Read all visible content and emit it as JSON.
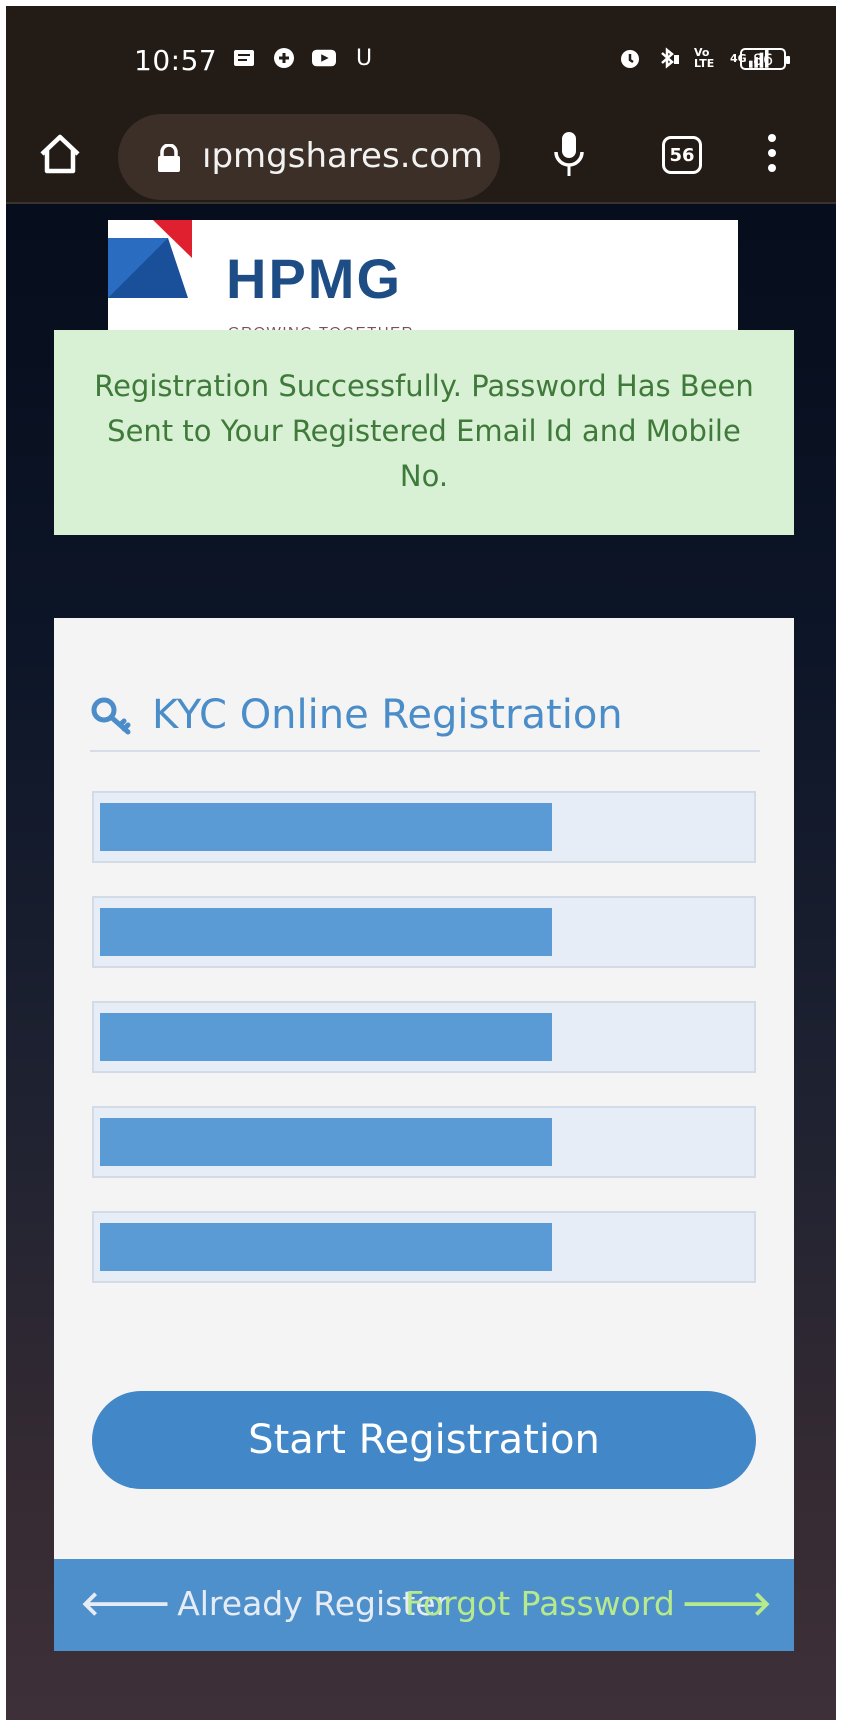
{
  "status_bar": {
    "time": "10:57",
    "left_icons": [
      "message-icon",
      "sync-icon",
      "youtube-icon",
      "u-icon"
    ],
    "u_label": "U",
    "network_label": "Vo LTE",
    "signal_label": "4G",
    "battery": "86"
  },
  "browser": {
    "url": "ıpmgshares.com",
    "tab_count": "56"
  },
  "logo": {
    "brand": "HPMG",
    "tagline": "GROWING TOGETHER",
    "colors": {
      "navy": "#1d4d84",
      "red": "#e0202f",
      "blue": "#1a4f9a"
    }
  },
  "alert": {
    "message": "Registration Successfully. Password Has Been Sent to Your Registered Email Id and Mobile No."
  },
  "form": {
    "title": "KYC Online Registration",
    "fields": [
      {
        "value": ""
      },
      {
        "value": ""
      },
      {
        "value": ""
      },
      {
        "value": ""
      },
      {
        "value": ""
      }
    ],
    "submit_label": "Start Registration"
  },
  "footer": {
    "left_link": "Already Register",
    "right_link": "Forgot Password"
  },
  "colors": {
    "accent": "#4287c8",
    "success_bg": "#d8f0d3",
    "success_text": "#3f7a3b",
    "footer_bg": "#4e90cc",
    "forgot_link": "#b7ea8c"
  }
}
